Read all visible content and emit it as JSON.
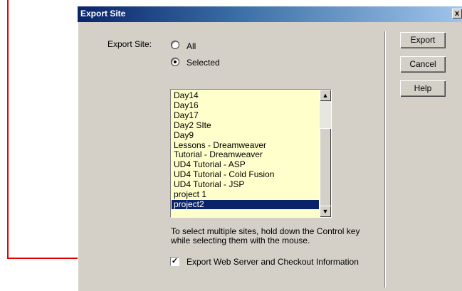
{
  "dialog": {
    "title": "Export Site",
    "close_label": "x",
    "export_site_label": "Export Site:",
    "radio_all_label": "All",
    "radio_selected_label": "Selected",
    "selected_option": "Selected",
    "sites": [
      "Day14",
      "Day16",
      "Day17",
      "Day2 SIte",
      "Day9",
      "Lessons - Dreamweaver",
      "Tutorial - Dreamweaver",
      "UD4 Tutorial - ASP",
      "UD4 Tutorial - Cold Fusion",
      "UD4 Tutorial - JSP",
      "project 1",
      "project2"
    ],
    "selected_site": "project2",
    "help_line1": "To select multiple sites, hold down the Control key",
    "help_line2": "while selecting them with the mouse.",
    "checkbox_label": "Export Web Server and Checkout Information",
    "checkbox_checked": true,
    "buttons": {
      "export": "Export",
      "cancel": "Cancel",
      "help": "Help"
    },
    "listbox_color": "#ffffcc",
    "selection_color": "#0a246a"
  },
  "annotation": {
    "arrow_color": "#e00000"
  }
}
